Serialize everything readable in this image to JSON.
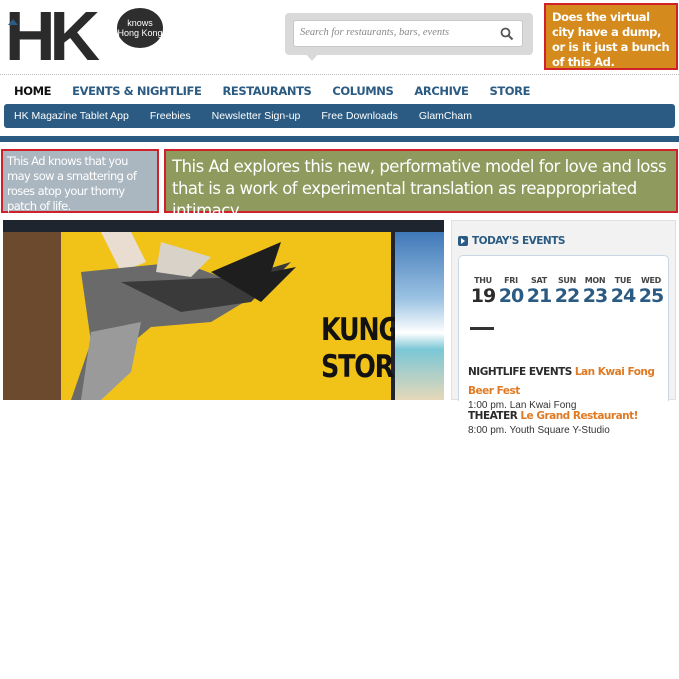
{
  "logo": {
    "letters": "HK",
    "badge_line1": "knows",
    "badge_line2": "Hong Kong"
  },
  "search": {
    "placeholder": "Search for restaurants, bars, events"
  },
  "ads": {
    "top_right": "Does the virtual city have a dump, or is it just a bunch of this Ad.",
    "left": "This Ad knows that you may sow a smattering of roses atop your thorny patch of life.",
    "wide": "This Ad explores this new, performative model for love and loss that is a work of experimental translation as reappropriated intimacy."
  },
  "main_nav": [
    "HOME",
    "EVENTS & NIGHTLIFE",
    "RESTAURANTS",
    "COLUMNS",
    "ARCHIVE",
    "STORE"
  ],
  "sub_nav": [
    "HK Magazine Tablet App",
    "Freebies",
    "Newsletter Sign-up",
    "Free Downloads",
    "GlamCham"
  ],
  "hero": {
    "title_line1": "KUNG FU",
    "title_line2": "STORIES"
  },
  "sidebar": {
    "heading": "TODAY'S EVENTS",
    "days": [
      {
        "name": "THU",
        "num": "19"
      },
      {
        "name": "FRI",
        "num": "20"
      },
      {
        "name": "SAT",
        "num": "21"
      },
      {
        "name": "SUN",
        "num": "22"
      },
      {
        "name": "MON",
        "num": "23"
      },
      {
        "name": "TUE",
        "num": "24"
      },
      {
        "name": "WED",
        "num": "25"
      }
    ],
    "events": [
      {
        "type": "NIGHTLIFE EVENTS",
        "name": "Lan Kwai Fong Beer Fest",
        "detail": "1:00 pm. Lan Kwai Fong"
      },
      {
        "type": "THEATER",
        "name": "Le Grand Restaurant!",
        "detail": "8:00 pm. Youth Square Y-Studio"
      }
    ]
  },
  "colors": {
    "brand_blue": "#2b5b82",
    "accent_orange": "#e07a22",
    "ad_border": "#d0202a"
  }
}
